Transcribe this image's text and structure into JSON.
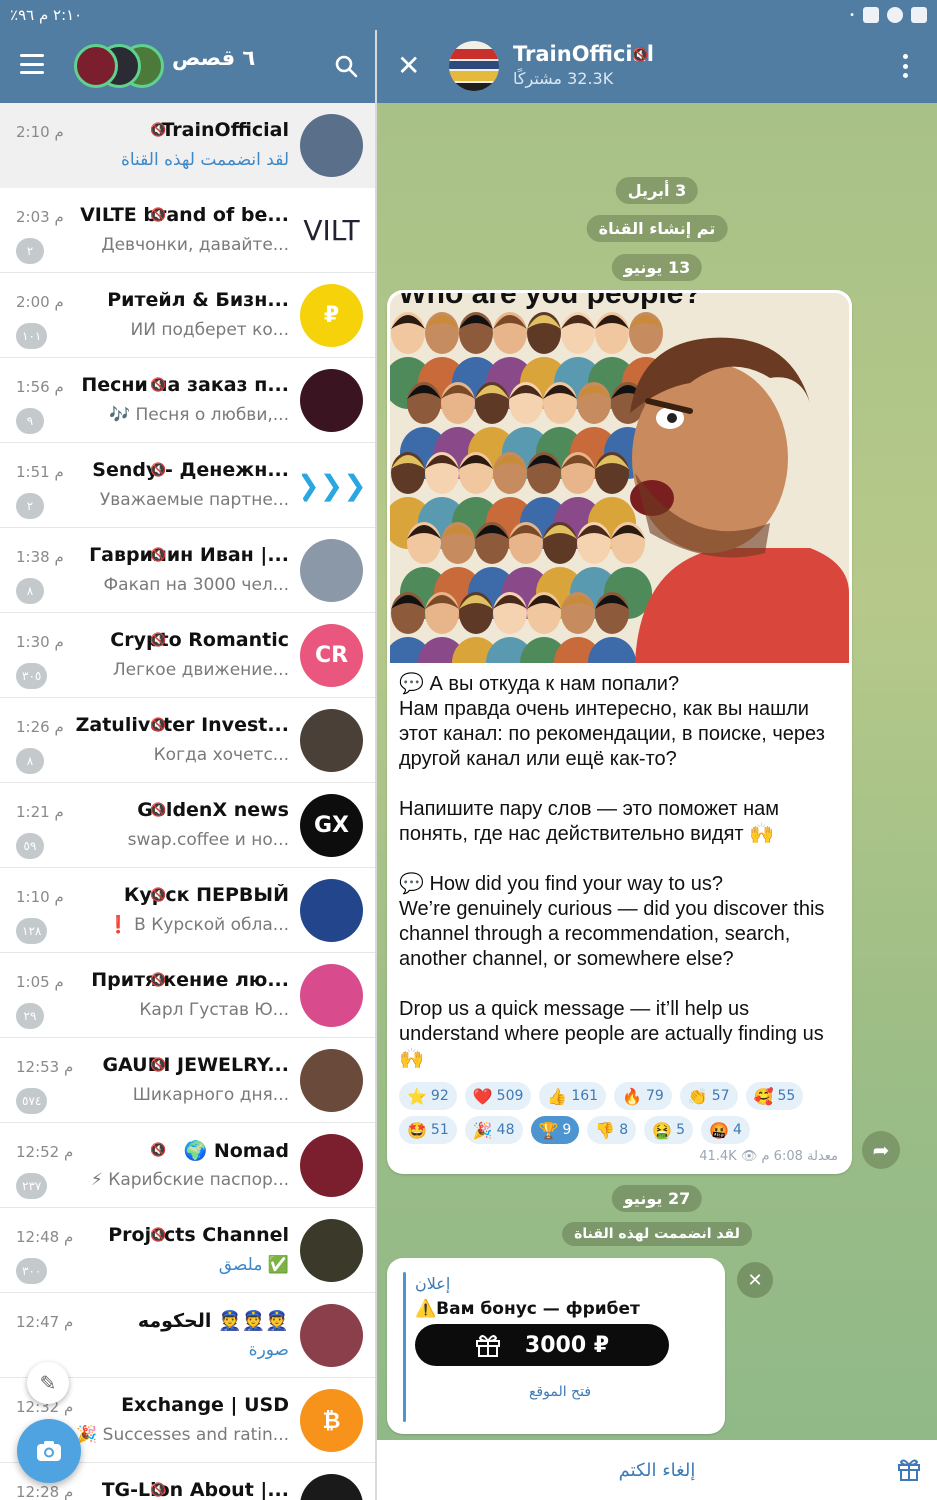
{
  "status_bar": {
    "left_text": "٢:١٠ م  ٩٦٪",
    "icons": [
      "battery-icon",
      "signal-icon",
      "wifi-icon",
      "alarm-icon",
      "gallery-icon",
      "whatsapp-icon",
      "flipboard-icon",
      "dot-icon"
    ]
  },
  "list_header": {
    "stories_title": "٦ قصص",
    "menu_icon": "hamburger-icon",
    "search_icon": "search-icon"
  },
  "chats": [
    {
      "name": "TrainOfficial",
      "time": "2:10 م",
      "preview": "لقد انضممت لهذه القناة",
      "preview_style": "blue",
      "badge": "",
      "muted": true,
      "avatar_color": "#5a6f8a",
      "avatar_text": ""
    },
    {
      "name": "VILTE brand of be...",
      "time": "2:03 م",
      "preview": "Девчонки, давайте...",
      "badge": "٢",
      "muted": true,
      "avatar_color": "#ffffff",
      "avatar_text": "VILT"
    },
    {
      "name": "Ритейл & Бизн...",
      "time": "2:00 م",
      "preview": "ИИ подберет ко...",
      "badge": "١٠١",
      "muted": false,
      "avatar_color": "#f5d20a",
      "avatar_text": "₽"
    },
    {
      "name": "Песни на заказ п...",
      "time": "1:56 م",
      "preview": "🎶 Песня о любви,...",
      "badge": "٩",
      "muted": true,
      "avatar_color": "#3a1420",
      "avatar_text": ""
    },
    {
      "name": "Sendy - Денежн...",
      "time": "1:51 م",
      "preview": "Уважаемые партне...",
      "badge": "٢",
      "muted": true,
      "avatar_color": "#ffffff",
      "avatar_text": "❯❯❯"
    },
    {
      "name": "Гаврилин Иван |...",
      "time": "1:38 م",
      "preview": "Факап на 3000 чел...",
      "badge": "٨",
      "muted": true,
      "avatar_color": "#8b98a8",
      "avatar_text": ""
    },
    {
      "name": "Crypto Romantic",
      "time": "1:30 م",
      "preview": "Легкое движение...",
      "badge": "٣٠٥",
      "muted": true,
      "avatar_color": "#e9577e",
      "avatar_text": "CR"
    },
    {
      "name": "Zatuliveter Invest...",
      "time": "1:26 م",
      "preview": "Когда хочетс...",
      "badge": "٨",
      "muted": true,
      "avatar_color": "#4a4038",
      "avatar_text": ""
    },
    {
      "name": "GoldenX news",
      "time": "1:21 م",
      "preview": "swap.coffee и но...",
      "badge": "٥٩",
      "muted": true,
      "avatar_color": "#0d0d0d",
      "avatar_text": "GX"
    },
    {
      "name": "Курск ПЕРВЫЙ",
      "time": "1:10 م",
      "preview": "❗ В Курской обла...",
      "badge": "١٢٨",
      "muted": true,
      "avatar_color": "#23458c",
      "avatar_text": ""
    },
    {
      "name": "Притяжение лю...",
      "time": "1:05 م",
      "preview": "Карл Густав Ю...",
      "badge": "٢٩",
      "muted": true,
      "avatar_color": "#d84c8e",
      "avatar_text": ""
    },
    {
      "name": "GAUDI JEWELRY...",
      "time": "12:53 م",
      "preview": "Шикарного дня...",
      "badge": "٥٧٤",
      "muted": true,
      "avatar_color": "#6a4a3a",
      "avatar_text": ""
    },
    {
      "name": "🌍 Nomad",
      "time": "12:52 م",
      "preview": "⚡ Карибские паспор...",
      "badge": "٢٣٧",
      "muted": true,
      "avatar_color": "#7b1f2e",
      "avatar_text": ""
    },
    {
      "name": "Projects Channel",
      "time": "12:48 م",
      "preview": "✅ ملصق",
      "preview_style": "blue",
      "badge": "٣٠٠",
      "muted": true,
      "avatar_color": "#3b3a2a",
      "avatar_text": ""
    },
    {
      "name": "الحكومه 👮👮👮",
      "time": "12:47 م",
      "preview": "صورة",
      "preview_style": "blue",
      "badge": "",
      "muted": false,
      "avatar_color": "#8a3f4a",
      "avatar_text": ""
    },
    {
      "name": "Exchange | USD",
      "time": "12:32 م",
      "preview": "🎉 Successes and ratin...",
      "badge": "",
      "muted": false,
      "avatar_color": "#f7931a",
      "avatar_text": "₿"
    },
    {
      "name": "TG-Lion About |...",
      "time": "12:28 م",
      "preview": "",
      "badge": "",
      "muted": true,
      "avatar_color": "#1a1a1a",
      "avatar_text": ""
    }
  ],
  "channel": {
    "title": "TrainOfficial",
    "subscribers": "32.3K مشتركًا",
    "close_icon": "close-icon",
    "more_icon": "kebab-menu-icon"
  },
  "date_pills": {
    "d1": "3 أبريل",
    "created": "تم إنشاء القناة",
    "d2": "13 يونيو",
    "d3": "27 يونيو",
    "joined": "لقد انضممت لهذه القناة"
  },
  "post": {
    "image_caption": "Who are you people?",
    "paragraphs": [
      "💬 А вы откуда к нам попали?\nНам правда очень интересно, как вы нашли этот канал: по рекомендации, в поиске, через другой канал или ещё как-то?",
      "Напишите пару слов — это поможет нам понять, где нас действительно видят 🙌",
      "💬 How did you find your way to us?\nWe’re genuinely curious — did you discover this channel through a recommendation, search, another channel, or somewhere else?",
      "Drop us a quick message — it’ll help us understand where people are actually finding us 🙌"
    ],
    "reactions": [
      {
        "emoji": "⭐",
        "count": "92",
        "chosen": false
      },
      {
        "emoji": "❤️",
        "count": "509",
        "chosen": false
      },
      {
        "emoji": "👍",
        "count": "161",
        "chosen": false
      },
      {
        "emoji": "🔥",
        "count": "79",
        "chosen": false
      },
      {
        "emoji": "👏",
        "count": "57",
        "chosen": false
      },
      {
        "emoji": "🥰",
        "count": "55",
        "chosen": false
      },
      {
        "emoji": "🤩",
        "count": "51",
        "chosen": false
      },
      {
        "emoji": "🎉",
        "count": "48",
        "chosen": false
      },
      {
        "emoji": "🏆",
        "count": "9",
        "chosen": true
      },
      {
        "emoji": "👎",
        "count": "8",
        "chosen": false
      },
      {
        "emoji": "🤮",
        "count": "5",
        "chosen": false
      },
      {
        "emoji": "🤬",
        "count": "4",
        "chosen": false
      }
    ],
    "meta": "معدلة 6:08 م  👁 41.4K"
  },
  "ad": {
    "label": "إعلان",
    "title": "⚠️Вам бонус — фрибет",
    "button_amount": "3000 ₽",
    "link": "فتح الموقع"
  },
  "bottom": {
    "unmute": "إلغاء الكتم",
    "gift_icon": "gift-icon"
  }
}
